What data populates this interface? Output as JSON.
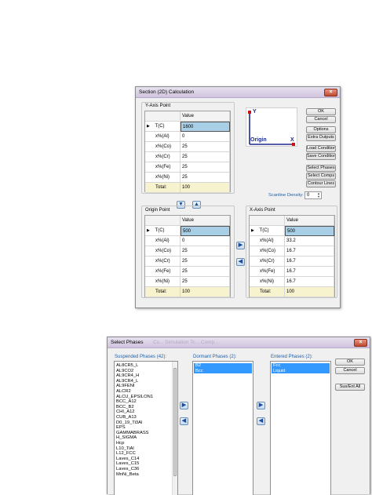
{
  "section_dialog": {
    "title": "Section (2D) Calculation",
    "y_axis_label": "Y-Axis Point",
    "value_header": "Value",
    "y_rows": [
      {
        "name": "T(C)",
        "value": "1600"
      },
      {
        "name": "x%(Al)",
        "value": "0"
      },
      {
        "name": "x%(Co)",
        "value": "25"
      },
      {
        "name": "x%(Cr)",
        "value": "25"
      },
      {
        "name": "x%(Fe)",
        "value": "25"
      },
      {
        "name": "x%(Ni)",
        "value": "25"
      }
    ],
    "y_total": {
      "name": "Total:",
      "value": "100"
    },
    "preview": {
      "y": "Y",
      "x": "X",
      "origin": "Origin"
    },
    "buttons": {
      "ok": "OK",
      "cancel": "Cancel",
      "options": "Options",
      "extra_outputs": "Extra Outputs",
      "load_condition": "Load Condition",
      "save_condition": "Save Condition",
      "select_phases": "Select Phases",
      "select_comps": "Select Comps",
      "contour_lines": "Contour Lines"
    },
    "scanline": {
      "label": "Scanline Density:",
      "value": "0"
    },
    "origin_label": "Origin Point",
    "origin_rows": [
      {
        "name": "T(C)",
        "value": "500"
      },
      {
        "name": "x%(Al)",
        "value": "0"
      },
      {
        "name": "x%(Co)",
        "value": "25"
      },
      {
        "name": "x%(Cr)",
        "value": "25"
      },
      {
        "name": "x%(Fe)",
        "value": "25"
      },
      {
        "name": "x%(Ni)",
        "value": "25"
      }
    ],
    "origin_total": {
      "name": "Total:",
      "value": "100"
    },
    "x_axis_label": "X-Axis Point",
    "x_rows": [
      {
        "name": "T(C)",
        "value": "500"
      },
      {
        "name": "x%(Al)",
        "value": "33.2"
      },
      {
        "name": "x%(Co)",
        "value": "16.7"
      },
      {
        "name": "x%(Cr)",
        "value": "16.7"
      },
      {
        "name": "x%(Fe)",
        "value": "16.7"
      },
      {
        "name": "x%(Ni)",
        "value": "16.7"
      }
    ],
    "x_total": {
      "name": "Total:",
      "value": "100"
    }
  },
  "phases_dialog": {
    "title": "Select Phases",
    "title_faded": "Cs... Simulation  Tc...  Comp...",
    "suspended_label": "Suspended Phases (42):",
    "suspended": [
      "AL8CR5_L",
      "AL9CO2",
      "AL9CR4_H",
      "AL9CR4_L",
      "AL9FENI",
      "ALCR2",
      "ALCU_EPSILON1",
      "BCC_A12",
      "BCC_B2",
      "CHI_A12",
      "CUB_A13",
      "D0_19_Ti3Al",
      "EPS",
      "GAMMABRASS",
      "H_SIGMA",
      "Hcp",
      "L10_TiAl",
      "L12_FCC",
      "Laves_C14",
      "Laves_C15",
      "Laves_C36",
      "MnNi_Beta"
    ],
    "dormant_label": "Dormant Phases (2):",
    "dormant": [
      "B2",
      "Bcc"
    ],
    "entered_label": "Entered Phases (2):",
    "entered": [
      "Fcc",
      "Liquid"
    ],
    "buttons": {
      "ok": "OK",
      "cancel": "Cancel",
      "sus_ent_all": "Sus/Ent All"
    }
  },
  "colors": {
    "axis": "#1b2a8c",
    "axis_end": "#cc1111",
    "selection": "#3399ff"
  }
}
